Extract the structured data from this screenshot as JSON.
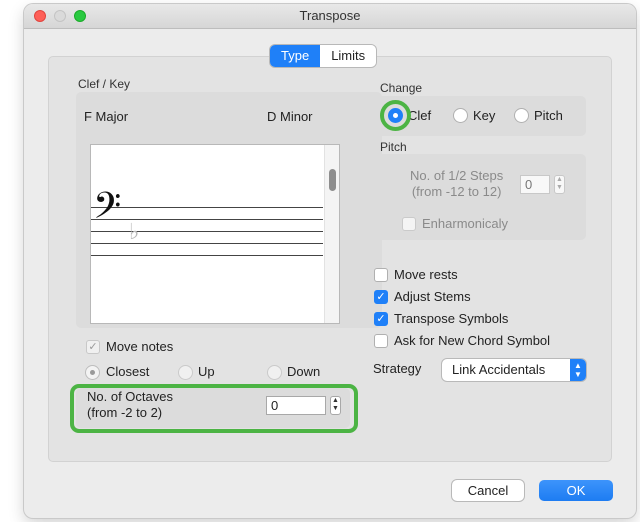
{
  "window": {
    "title": "Transpose"
  },
  "tabs": [
    {
      "label": "Type",
      "active": true
    },
    {
      "label": "Limits",
      "active": false
    }
  ],
  "clef_key": {
    "section_label": "Clef / Key",
    "from_key": "F Major",
    "to_key": "D Minor",
    "clef_glyph": "𝄢",
    "accidental_glyph": "♭"
  },
  "octave_options": {
    "move_notes_label": "Move notes",
    "move_notes_checked": true,
    "direction_options": [
      "Closest",
      "Up",
      "Down"
    ],
    "selected_direction": "Closest",
    "octaves_label_line1": "No. of Octaves",
    "octaves_label_line2": "(from -2 to 2)",
    "octaves_value": "0"
  },
  "change": {
    "section_label": "Change",
    "options": [
      "Clef",
      "Key",
      "Pitch"
    ],
    "selected": "Clef"
  },
  "pitch": {
    "section_label": "Pitch",
    "steps_label_line1": "No. of 1/2 Steps",
    "steps_label_line2": "(from -12 to 12)",
    "steps_value": "0",
    "enharmonic_label": "Enharmonicaly",
    "enharmonic_checked": false
  },
  "options": [
    {
      "label": "Move rests",
      "checked": false
    },
    {
      "label": "Adjust Stems",
      "checked": true
    },
    {
      "label": "Transpose Symbols",
      "checked": true
    },
    {
      "label": "Ask for New Chord Symbol",
      "checked": false
    }
  ],
  "strategy": {
    "label": "Strategy",
    "value": "Link Accidentals"
  },
  "buttons": {
    "cancel": "Cancel",
    "ok": "OK"
  },
  "colors": {
    "accent": "#1f80f8",
    "highlight": "#4cb444"
  }
}
